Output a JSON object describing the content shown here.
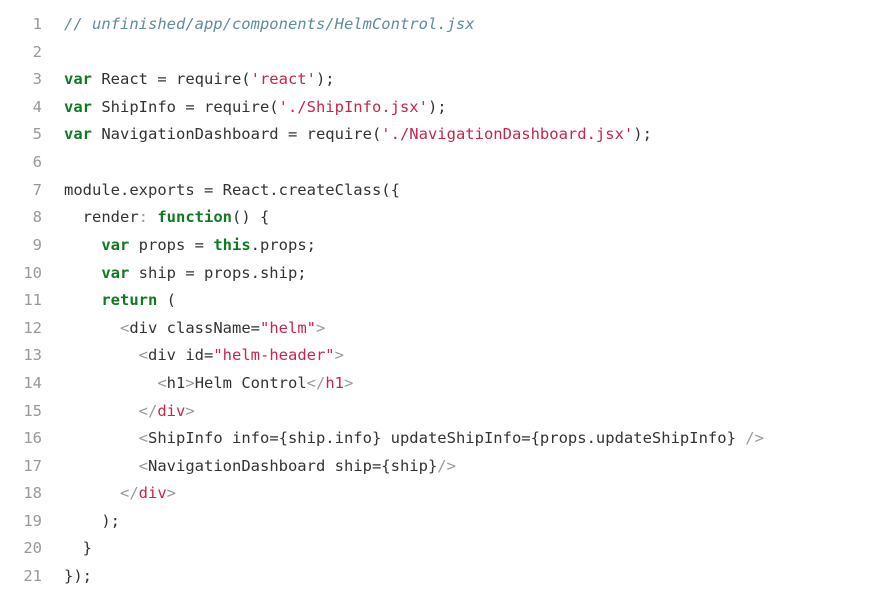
{
  "editor": {
    "file_path": "unfinished/app/components/HelmControl.jsx",
    "lines": [
      {
        "number": "1",
        "tokens": [
          {
            "t": "// unfinished/app/components/HelmControl.jsx",
            "k": "comment"
          }
        ]
      },
      {
        "number": "2",
        "tokens": []
      },
      {
        "number": "3",
        "tokens": [
          {
            "t": "var",
            "k": "keyword"
          },
          {
            "t": " React = require(",
            "k": "plain"
          },
          {
            "t": "'react'",
            "k": "string"
          },
          {
            "t": ");",
            "k": "plain"
          }
        ]
      },
      {
        "number": "4",
        "tokens": [
          {
            "t": "var",
            "k": "keyword"
          },
          {
            "t": " ShipInfo = require(",
            "k": "plain"
          },
          {
            "t": "'./ShipInfo.jsx'",
            "k": "string"
          },
          {
            "t": ");",
            "k": "plain"
          }
        ]
      },
      {
        "number": "5",
        "tokens": [
          {
            "t": "var",
            "k": "keyword"
          },
          {
            "t": " NavigationDashboard = require(",
            "k": "plain"
          },
          {
            "t": "'./NavigationDashboard.jsx'",
            "k": "string"
          },
          {
            "t": ");",
            "k": "plain"
          }
        ]
      },
      {
        "number": "6",
        "tokens": []
      },
      {
        "number": "7",
        "tokens": [
          {
            "t": "module.exports = React.createClass({",
            "k": "plain"
          }
        ]
      },
      {
        "number": "8",
        "tokens": [
          {
            "t": "  render",
            "k": "plain"
          },
          {
            "t": ":",
            "k": "colon"
          },
          {
            "t": " ",
            "k": "plain"
          },
          {
            "t": "function",
            "k": "keyword"
          },
          {
            "t": "() {",
            "k": "plain"
          }
        ]
      },
      {
        "number": "9",
        "tokens": [
          {
            "t": "    ",
            "k": "plain"
          },
          {
            "t": "var",
            "k": "keyword"
          },
          {
            "t": " props = ",
            "k": "plain"
          },
          {
            "t": "this",
            "k": "keyword"
          },
          {
            "t": ".props;",
            "k": "plain"
          }
        ]
      },
      {
        "number": "10",
        "tokens": [
          {
            "t": "    ",
            "k": "plain"
          },
          {
            "t": "var",
            "k": "keyword"
          },
          {
            "t": " ship = props.ship;",
            "k": "plain"
          }
        ]
      },
      {
        "number": "11",
        "tokens": [
          {
            "t": "    ",
            "k": "plain"
          },
          {
            "t": "return",
            "k": "keyword"
          },
          {
            "t": " (",
            "k": "plain"
          }
        ]
      },
      {
        "number": "12",
        "tokens": [
          {
            "t": "      ",
            "k": "plain"
          },
          {
            "t": "<",
            "k": "bracket"
          },
          {
            "t": "div className=",
            "k": "plain"
          },
          {
            "t": "\"helm\"",
            "k": "string"
          },
          {
            "t": ">",
            "k": "bracket"
          }
        ]
      },
      {
        "number": "13",
        "tokens": [
          {
            "t": "        ",
            "k": "plain"
          },
          {
            "t": "<",
            "k": "bracket"
          },
          {
            "t": "div id=",
            "k": "plain"
          },
          {
            "t": "\"helm-header\"",
            "k": "string"
          },
          {
            "t": ">",
            "k": "bracket"
          }
        ]
      },
      {
        "number": "14",
        "tokens": [
          {
            "t": "          ",
            "k": "plain"
          },
          {
            "t": "<",
            "k": "bracket"
          },
          {
            "t": "h1",
            "k": "plain"
          },
          {
            "t": ">",
            "k": "bracket"
          },
          {
            "t": "Helm Control",
            "k": "plain"
          },
          {
            "t": "</",
            "k": "bracket"
          },
          {
            "t": "h1",
            "k": "tag"
          },
          {
            "t": ">",
            "k": "bracket"
          }
        ]
      },
      {
        "number": "15",
        "tokens": [
          {
            "t": "        ",
            "k": "plain"
          },
          {
            "t": "</",
            "k": "bracket"
          },
          {
            "t": "div",
            "k": "tag"
          },
          {
            "t": ">",
            "k": "bracket"
          }
        ]
      },
      {
        "number": "16",
        "tokens": [
          {
            "t": "        ",
            "k": "plain"
          },
          {
            "t": "<",
            "k": "bracket"
          },
          {
            "t": "ShipInfo info={ship.info} updateShipInfo={props.updateShipInfo} ",
            "k": "plain"
          },
          {
            "t": "/>",
            "k": "bracket"
          }
        ]
      },
      {
        "number": "17",
        "tokens": [
          {
            "t": "        ",
            "k": "plain"
          },
          {
            "t": "<",
            "k": "bracket"
          },
          {
            "t": "NavigationDashboard ship={ship}",
            "k": "plain"
          },
          {
            "t": "/>",
            "k": "bracket"
          }
        ]
      },
      {
        "number": "18",
        "tokens": [
          {
            "t": "      ",
            "k": "plain"
          },
          {
            "t": "</",
            "k": "bracket"
          },
          {
            "t": "div",
            "k": "tag"
          },
          {
            "t": ">",
            "k": "bracket"
          }
        ]
      },
      {
        "number": "19",
        "tokens": [
          {
            "t": "    );",
            "k": "plain"
          }
        ]
      },
      {
        "number": "20",
        "tokens": [
          {
            "t": "  }",
            "k": "plain"
          }
        ]
      },
      {
        "number": "21",
        "tokens": [
          {
            "t": "});",
            "k": "plain"
          }
        ]
      }
    ]
  }
}
